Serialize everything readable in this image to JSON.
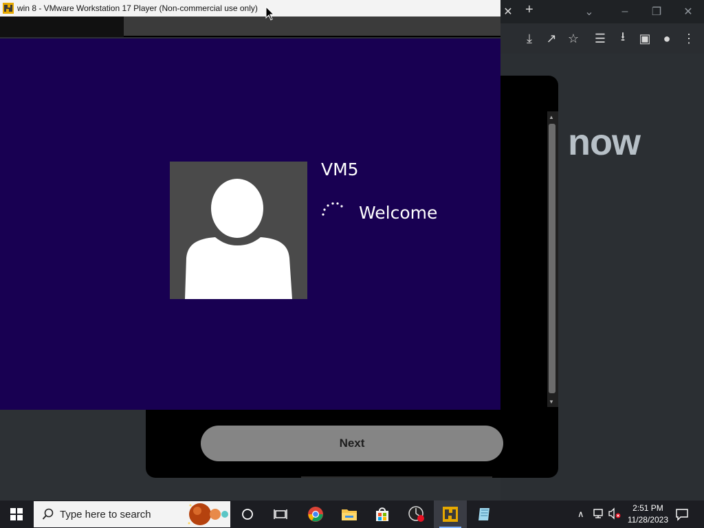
{
  "vmware": {
    "title": "win 8 - VMware Workstation 17 Player (Non-commercial use only)"
  },
  "guest": {
    "username": "VM5",
    "status": "Welcome"
  },
  "browser": {
    "page_logo_text": "now",
    "next_button_label": "Next"
  },
  "taskbar": {
    "search_placeholder": "Type here to search",
    "time": "2:51 PM",
    "date": "11/28/2023"
  },
  "colors": {
    "guest_background": "#180052",
    "avatar_tile": "#4a4a4a",
    "taskbar": "#1c1d22",
    "next_button": "#858585"
  }
}
